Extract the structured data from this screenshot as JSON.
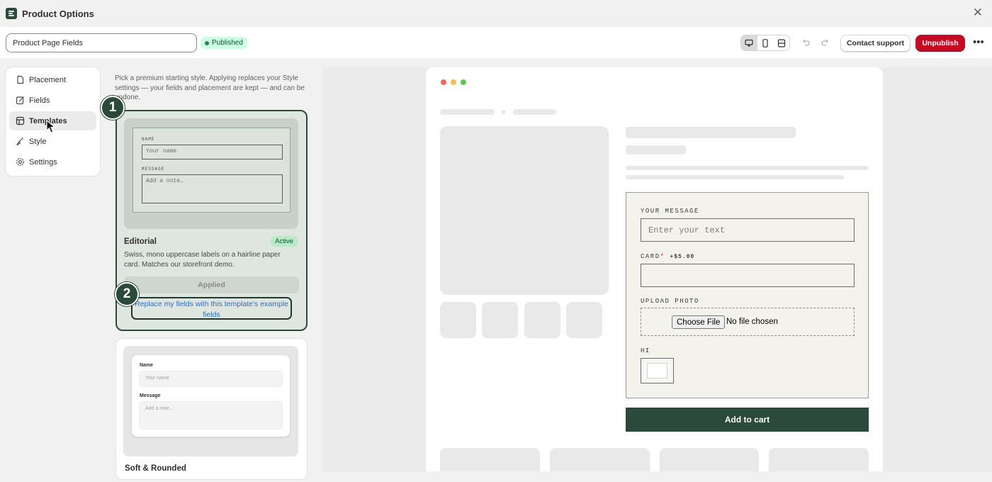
{
  "app": {
    "title": "Product Options"
  },
  "toolbar": {
    "page_name": "Product Page Fields",
    "status_badge": "Published",
    "contact_support": "Contact support",
    "unpublish": "Unpublish"
  },
  "sidebar": {
    "items": [
      {
        "label": "Placement",
        "icon": "page-icon"
      },
      {
        "label": "Fields",
        "icon": "edit-icon"
      },
      {
        "label": "Templates",
        "icon": "template-icon",
        "active": true
      },
      {
        "label": "Style",
        "icon": "brush-icon"
      },
      {
        "label": "Settings",
        "icon": "gear-icon"
      }
    ]
  },
  "templates_panel": {
    "description": "Pick a premium starting style. Applying replaces your Style settings — your fields and placement are kept — and can be undone.",
    "templates": [
      {
        "name": "Editorial",
        "badge": "Active",
        "description": "Swiss, mono uppercase labels on a hairline paper card. Matches our storefront demo.",
        "preview": {
          "label_1": "NAME",
          "placeholder_1": "Your name",
          "label_2": "MESSAGE",
          "placeholder_2": "Add a note…"
        },
        "applied_button": "Applied",
        "replace_link": "Replace my fields with this template's example fields"
      },
      {
        "name": "Soft & Rounded",
        "preview": {
          "label_1": "Name",
          "placeholder_1": "Your name",
          "label_2": "Message",
          "placeholder_2": "Add a note..."
        }
      }
    ],
    "step_markers": [
      "1",
      "2"
    ]
  },
  "preview": {
    "form": {
      "field_1_label": "YOUR MESSAGE",
      "field_1_placeholder": "Enter your text",
      "field_2_label": "CARD",
      "field_2_required": "*",
      "field_2_price": "+$5.00",
      "field_3_label": "UPLOAD PHOTO",
      "choose_file": "Choose File",
      "no_file": "No file chosen",
      "field_4_label": "HI"
    },
    "add_to_cart": "Add to cart"
  },
  "colors": {
    "brand_green": "#2b4a3b",
    "published_bg": "#cdfee1",
    "unpublish_red": "#c70a24",
    "link_blue": "#2c6ecb"
  }
}
